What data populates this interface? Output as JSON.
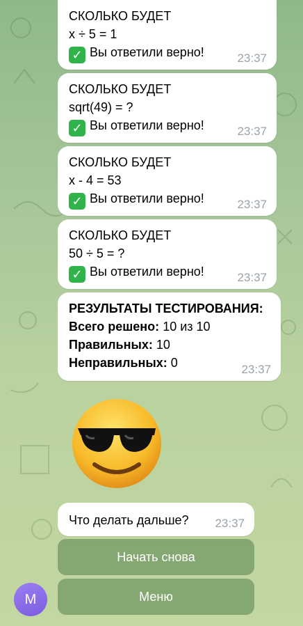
{
  "messages": [
    {
      "question": "СКОЛЬКО БУДЕТ",
      "expression": "x ÷ 5 = 1",
      "check_icon": "white-check-mark-icon",
      "result": "Вы ответили верно!",
      "time": "23:37"
    },
    {
      "question": "СКОЛЬКО БУДЕТ",
      "expression": "sqrt(49) = ?",
      "check_icon": "white-check-mark-icon",
      "result": "Вы ответили верно!",
      "time": "23:37"
    },
    {
      "question": "СКОЛЬКО БУДЕТ",
      "expression": "x - 4 = 53",
      "check_icon": "white-check-mark-icon",
      "result": "Вы ответили верно!",
      "time": "23:37"
    },
    {
      "question": "СКОЛЬКО БУДЕТ",
      "expression": "50 ÷ 5 = ?",
      "check_icon": "white-check-mark-icon",
      "result": "Вы ответили верно!",
      "time": "23:37"
    }
  ],
  "results": {
    "title": "РЕЗУЛЬТАТЫ ТЕСТИРОВАНИЯ:",
    "total_label": "Всего решено:",
    "total_value": "10 из 10",
    "correct_label": "Правильных:",
    "correct_value": "10",
    "wrong_label": "Неправильных:",
    "wrong_value": "0",
    "time": "23:37"
  },
  "sticker": {
    "icon": "sunglasses-smiley-icon"
  },
  "prompt": {
    "text": "Что делать дальше?",
    "time": "23:37"
  },
  "buttons": {
    "restart": "Начать снова",
    "menu": "Меню"
  },
  "avatar": {
    "initial": "M",
    "color": "#8b6ce8"
  },
  "colors": {
    "bubble": "#ffffff",
    "timestamp": "#9aa3ab",
    "check_green": "#2fb34a",
    "button_bg": "#6e965f"
  }
}
